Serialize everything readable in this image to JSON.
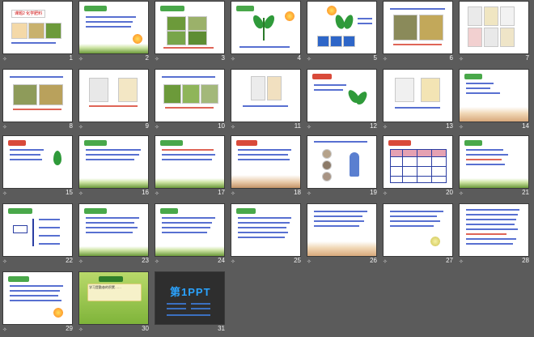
{
  "slides": [
    {
      "num": "1"
    },
    {
      "num": "2"
    },
    {
      "num": "3"
    },
    {
      "num": "4"
    },
    {
      "num": "5"
    },
    {
      "num": "6"
    },
    {
      "num": "7"
    },
    {
      "num": "8"
    },
    {
      "num": "9"
    },
    {
      "num": "10"
    },
    {
      "num": "11"
    },
    {
      "num": "12"
    },
    {
      "num": "13"
    },
    {
      "num": "14"
    },
    {
      "num": "15"
    },
    {
      "num": "16"
    },
    {
      "num": "17"
    },
    {
      "num": "18"
    },
    {
      "num": "19"
    },
    {
      "num": "20"
    },
    {
      "num": "21"
    },
    {
      "num": "22"
    },
    {
      "num": "23"
    },
    {
      "num": "24"
    },
    {
      "num": "25"
    },
    {
      "num": "26"
    },
    {
      "num": "27"
    },
    {
      "num": "28"
    },
    {
      "num": "29"
    },
    {
      "num": "30"
    },
    {
      "num": "31"
    }
  ],
  "slide1": {
    "title": "课题2  化学肥料"
  },
  "slide31": {
    "logo": "第1PPT"
  },
  "slide30": {
    "note": "学习是勤奋的积累……"
  },
  "colors": {
    "background": "#5b5b5b",
    "accent_green": "#49a84a",
    "text_blue": "#3b57c9"
  }
}
